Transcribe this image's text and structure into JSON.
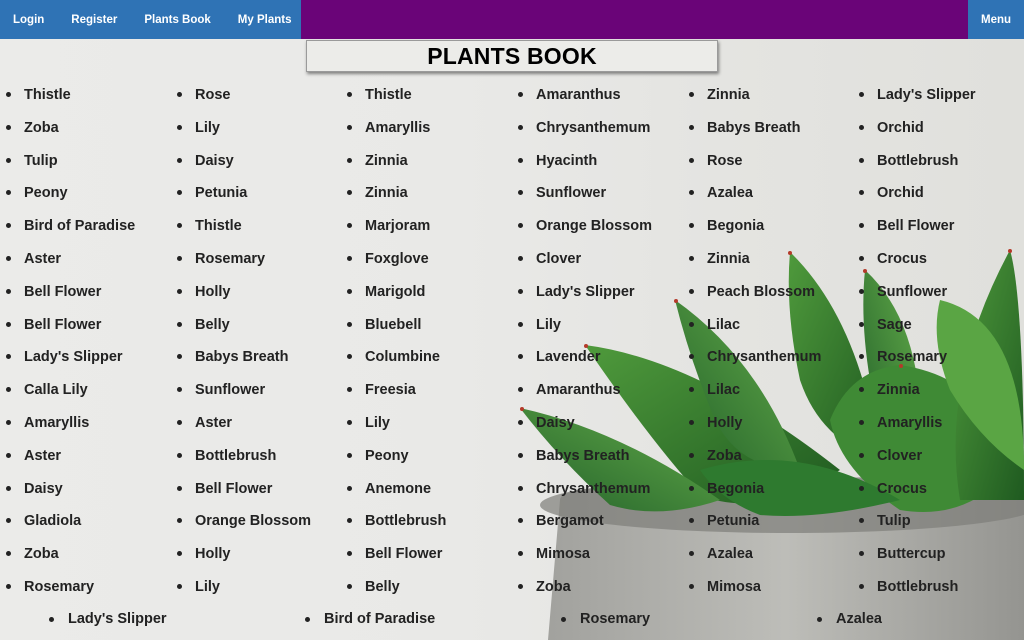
{
  "nav": {
    "login": "Login",
    "register": "Register",
    "plants_book": "Plants Book",
    "my_plants": "My Plants",
    "menu": "Menu"
  },
  "title": "PLANTS BOOK",
  "columns": [
    [
      "Thistle",
      "Zoba",
      "Tulip",
      "Peony",
      "Bird of Paradise",
      "Aster",
      "Bell Flower",
      "Bell Flower",
      "Lady's Slipper",
      "Calla Lily",
      "Amaryllis",
      "Aster",
      "Daisy",
      "Gladiola",
      "Zoba",
      "Rosemary"
    ],
    [
      "Rose",
      "Lily",
      "Daisy",
      "Petunia",
      "Thistle",
      "Rosemary",
      "Holly",
      "Belly",
      "Babys Breath",
      "Sunflower",
      "Aster",
      "Bottlebrush",
      "Bell Flower",
      "Orange Blossom",
      "Holly",
      "Lily"
    ],
    [
      "Thistle",
      "Amaryllis",
      "Zinnia",
      "Zinnia",
      "Marjoram",
      "Foxglove",
      "Marigold",
      "Bluebell",
      "Columbine",
      "Freesia",
      "Lily",
      "Peony",
      "Anemone",
      "Bottlebrush",
      "Bell Flower",
      "Belly"
    ],
    [
      "Amaranthus",
      "Chrysanthemum",
      "Hyacinth",
      "Sunflower",
      "Orange Blossom",
      "Clover",
      "Lady's Slipper",
      "Lily",
      "Lavender",
      "Amaranthus",
      "Daisy",
      "Babys Breath",
      "Chrysanthemum",
      "Bergamot",
      "Mimosa",
      "Zoba"
    ],
    [
      "Zinnia",
      "Babys Breath",
      "Rose",
      "Azalea",
      "Begonia",
      "Zinnia",
      "Peach Blossom",
      "Lilac",
      "Chrysanthemum",
      "Lilac",
      "Holly",
      "Zoba",
      "Begonia",
      "Petunia",
      "Azalea",
      "Mimosa"
    ],
    [
      "Lady's Slipper",
      "Orchid",
      "Bottlebrush",
      "Orchid",
      "Bell Flower",
      "Crocus",
      "Sunflower",
      "Sage",
      "Rosemary",
      "Zinnia",
      "Amaryllis",
      "Clover",
      "Crocus",
      "Tulip",
      "Buttercup",
      "Bottlebrush"
    ]
  ],
  "last_row": [
    "Lady's Slipper",
    "Bird of Paradise",
    "Rosemary",
    "Azalea"
  ]
}
